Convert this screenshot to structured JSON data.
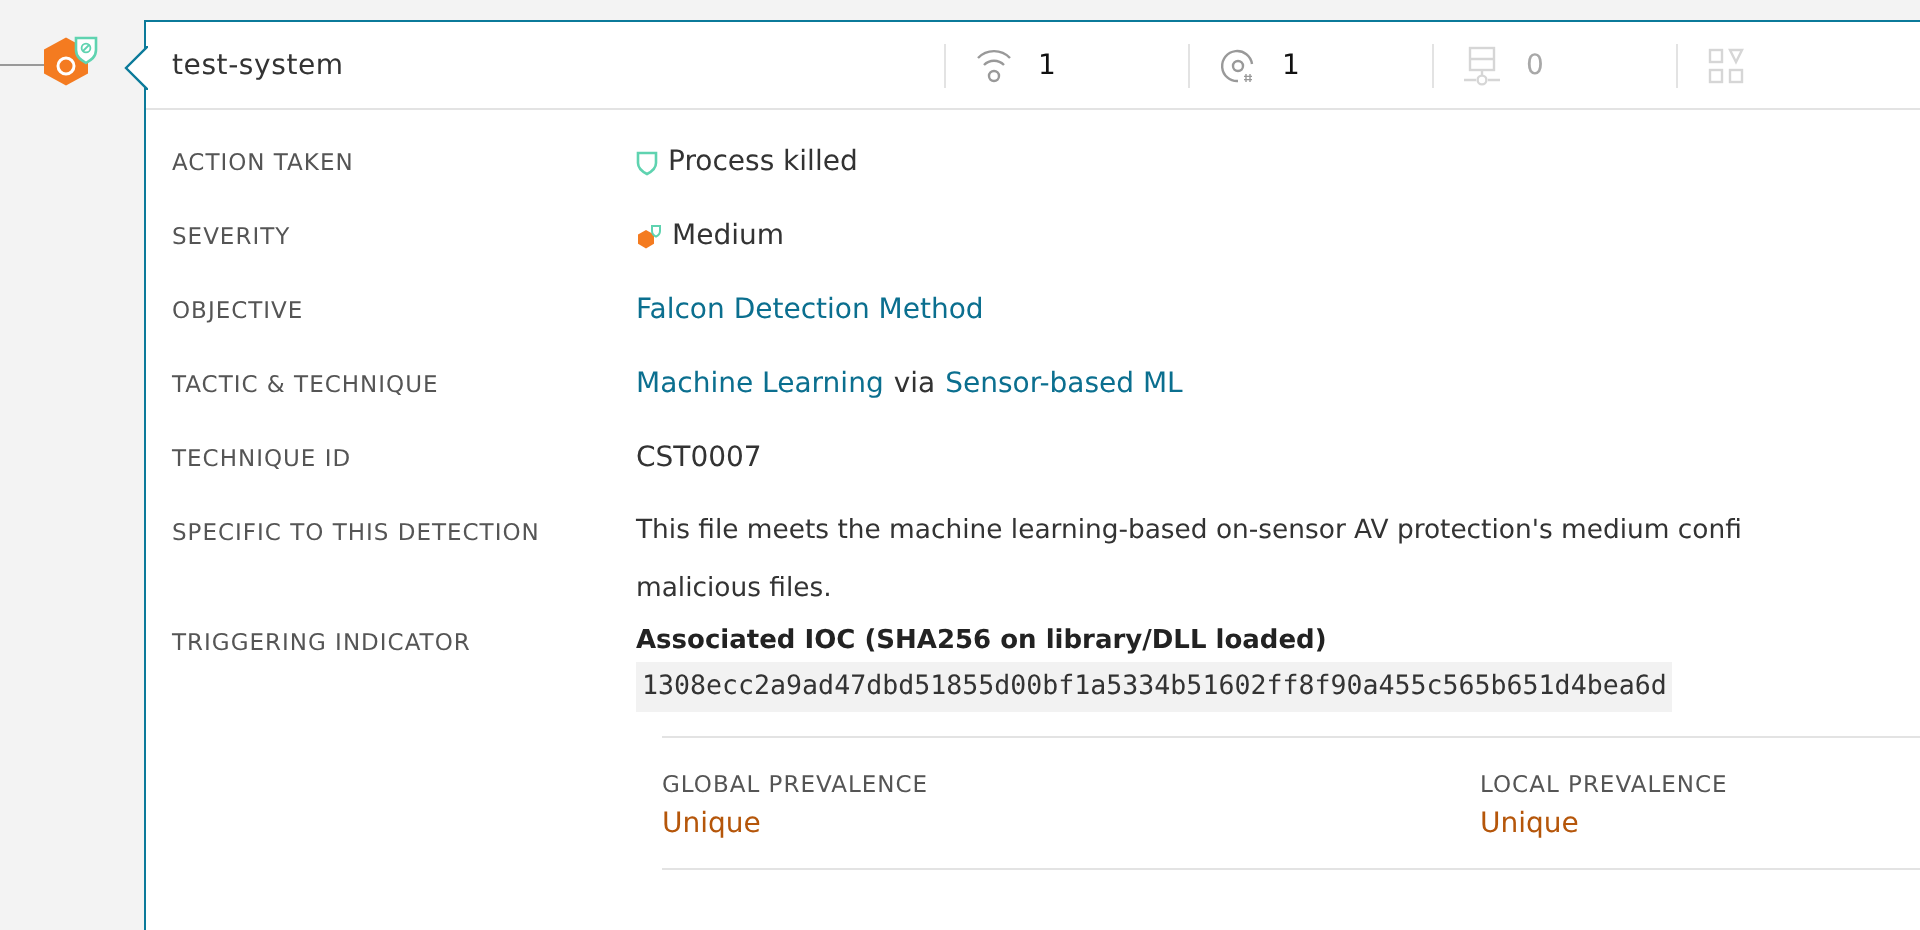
{
  "panel": {
    "title": "test-system",
    "stats": [
      {
        "kind": "wifi",
        "count": "1",
        "disabled": false
      },
      {
        "kind": "disc",
        "count": "1",
        "disabled": false
      },
      {
        "kind": "server",
        "count": "0",
        "disabled": true
      },
      {
        "kind": "grid",
        "disabled": true
      }
    ]
  },
  "details": [
    {
      "label": "ACTION TAKEN",
      "kind": "action",
      "value": "Process killed"
    },
    {
      "label": "SEVERITY",
      "kind": "severity",
      "value": "Medium"
    },
    {
      "label": "OBJECTIVE",
      "kind": "link",
      "value": "Falcon Detection Method"
    },
    {
      "label": "TACTIC & TECHNIQUE",
      "kind": "parts",
      "parts": [
        {
          "kind": "link",
          "text": "Machine Learning"
        },
        {
          "kind": "plain",
          "text": "via"
        },
        {
          "kind": "link",
          "text": "Sensor-based ML"
        }
      ]
    },
    {
      "label": "TECHNIQUE ID",
      "kind": "plain",
      "value": "CST0007"
    },
    {
      "label": "SPECIFIC TO THIS DETECTION",
      "kind": "lines",
      "lines": [
        "This file meets the machine learning-based on-sensor AV protection's medium confi",
        "malicious files."
      ]
    },
    {
      "label": "TRIGGERING INDICATOR",
      "kind": "ioc",
      "title": "Associated IOC (SHA256 on library/DLL loaded)",
      "value": "1308ecc2a9ad47dbd51855d00bf1a5334b51602ff8f90a455c565b651d4bea6d"
    }
  ],
  "prevalence": [
    {
      "label": "GLOBAL PREVALENCE",
      "value": "Unique"
    },
    {
      "label": "LOCAL PREVALENCE",
      "value": "Unique"
    }
  ]
}
